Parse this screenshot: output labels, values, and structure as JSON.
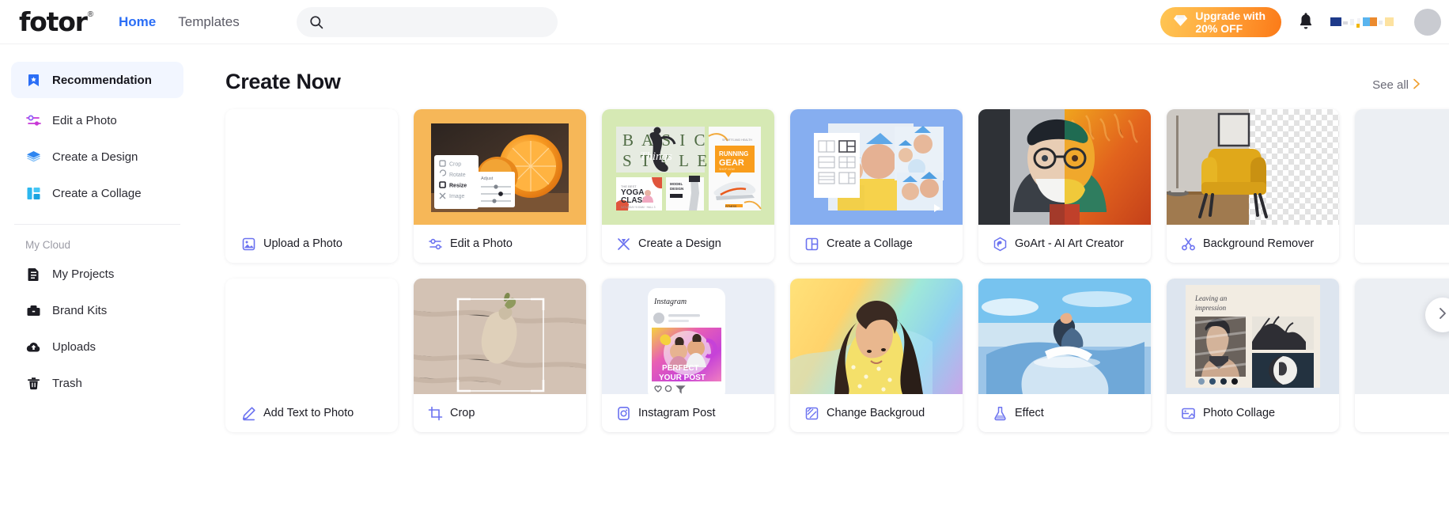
{
  "header": {
    "logo_text": "fotor",
    "logo_registered": "®",
    "nav": [
      {
        "label": "Home",
        "active": true
      },
      {
        "label": "Templates",
        "active": false
      }
    ],
    "search": {
      "value": "",
      "placeholder": "",
      "icon": "search-icon"
    },
    "upgrade_button": {
      "label": "Upgrade with\n20% OFF",
      "icon": "diamond-icon",
      "color_start": "#ffc654",
      "color_end": "#fc7a18"
    },
    "notifications_icon": "bell-icon",
    "avatar": "user-avatar"
  },
  "sidebar": {
    "items": [
      {
        "label": "Recommendation",
        "icon": "bookmark-star-icon",
        "active": true
      },
      {
        "label": "Edit a Photo",
        "icon": "sliders-icon",
        "active": false
      },
      {
        "label": "Create a Design",
        "icon": "layers-icon",
        "active": false
      },
      {
        "label": "Create a Collage",
        "icon": "collage-grid-icon",
        "active": false
      }
    ],
    "section_title": "My Cloud",
    "cloud_items": [
      {
        "label": "My Projects",
        "icon": "document-icon"
      },
      {
        "label": "Brand Kits",
        "icon": "briefcase-icon"
      },
      {
        "label": "Uploads",
        "icon": "cloud-upload-icon"
      },
      {
        "label": "Trash",
        "icon": "trash-icon"
      }
    ]
  },
  "main": {
    "section_title": "Create Now",
    "see_all": "See all",
    "see_all_icon": "chevron-right-icon",
    "carousel_next_icon": "chevron-right-icon",
    "cards": [
      {
        "label": "Upload a Photo",
        "icon": "upload-image-icon",
        "thumb": "plain"
      },
      {
        "label": "Edit a Photo",
        "icon": "sliders-icon",
        "thumb": "edit"
      },
      {
        "label": "Create a Design",
        "icon": "design-icon",
        "thumb": "design"
      },
      {
        "label": "Create a Collage",
        "icon": "collage-icon",
        "thumb": "collage"
      },
      {
        "label": "GoArt - AI Art Creator",
        "icon": "goart-icon",
        "thumb": "goart"
      },
      {
        "label": "Background Remover",
        "icon": "scissors-icon",
        "thumb": "bgrm"
      },
      {
        "label": "",
        "icon": "",
        "thumb": "none"
      },
      {
        "label": "Add Text to Photo",
        "icon": "pen-icon",
        "thumb": "plain"
      },
      {
        "label": "Crop",
        "icon": "crop-icon",
        "thumb": "crop"
      },
      {
        "label": "Instagram Post",
        "icon": "instagram-icon",
        "thumb": "insta"
      },
      {
        "label": "Change Backgroud",
        "icon": "hatch-square-icon",
        "thumb": "chbg"
      },
      {
        "label": "Effect",
        "icon": "flask-icon",
        "thumb": "effect"
      },
      {
        "label": "Photo Collage",
        "icon": "photo-collage-icon",
        "thumb": "photocol"
      },
      {
        "label": "",
        "icon": "",
        "thumb": "none"
      }
    ],
    "edit_thumb_menu": [
      "Crop",
      "Rotate",
      "Resize",
      "Image"
    ],
    "edit_thumb_panel_title": "Adjust",
    "design_thumb_texts": [
      "B A S I C",
      "S T Y L E S",
      "Things",
      "YOGA CLASS",
      "RUNNING GEAR",
      "MODEL DESIGN"
    ],
    "insta_thumb_texts": [
      "Instagram",
      "PERFECT",
      "YOUR POST"
    ],
    "photocol_thumb_texts": [
      "Leaving an",
      "impression"
    ]
  }
}
